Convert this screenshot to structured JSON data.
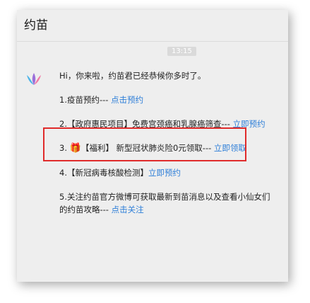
{
  "window": {
    "title": "约苗"
  },
  "chat": {
    "timestamp": "13:15",
    "greeting": "Hi，你来啦，约苗君已经恭候你多时了。",
    "items": [
      {
        "text": "1.疫苗预约--- ",
        "link": "点击预约"
      },
      {
        "text": "2.【政府惠民项目】免费宫颈癌和乳腺癌筛查--- ",
        "link": "立即预约"
      },
      {
        "prefix": "3. ",
        "icon": "gift-icon",
        "text": "【福利】 新型冠状肺炎险0元领取--- ",
        "link": "立即领取"
      },
      {
        "text": "4.【新冠病毒核酸检测】",
        "link": "立即预约"
      },
      {
        "text": "5.关注约苗官方微博可获取最新到苗消息以及查看小仙女们的约苗攻略--- ",
        "link": "点击关注"
      }
    ]
  },
  "colors": {
    "link": "#2f7fd8",
    "highlight": "#e02b2b",
    "background": "#eeeeee"
  }
}
